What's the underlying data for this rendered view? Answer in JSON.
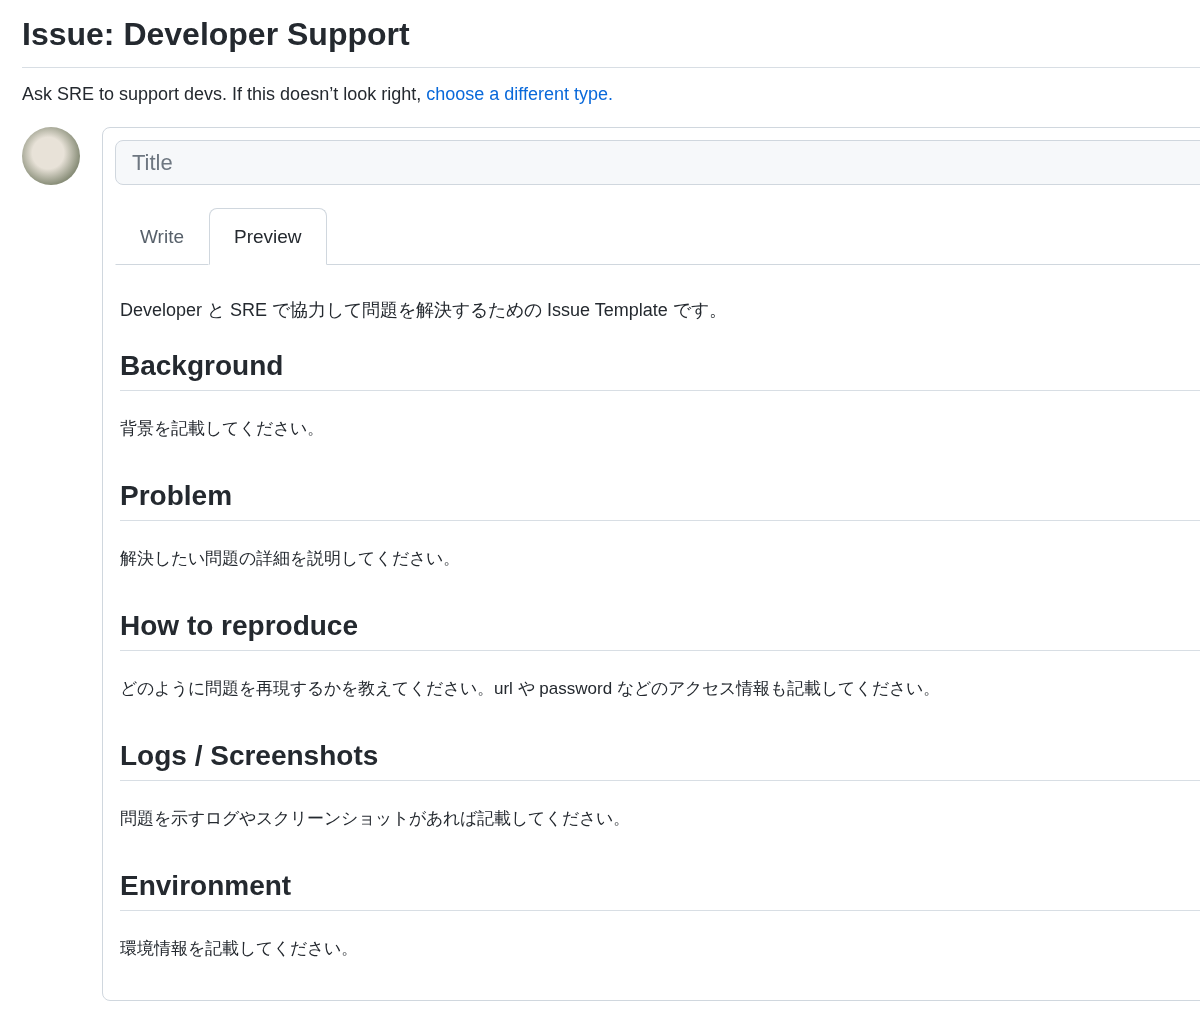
{
  "page_title": "Issue: Developer Support",
  "description": {
    "text": "Ask SRE to support devs. If this doesn’t look right, ",
    "link": "choose a different type."
  },
  "title_field": {
    "placeholder": "Title"
  },
  "tabs": [
    {
      "label": "Write",
      "selected": false
    },
    {
      "label": "Preview",
      "selected": true
    }
  ],
  "preview": {
    "intro": "Developer と SRE で協力して問題を解決するための Issue Template です。",
    "sections": [
      {
        "heading": "Background",
        "text": "背景を記載してください。"
      },
      {
        "heading": "Problem",
        "text": "解決したい問題の詳細を説明してください。"
      },
      {
        "heading": "How to reproduce",
        "text": "どのように問題を再現するかを教えてください。url や password などのアクセス情報も記載してください。"
      },
      {
        "heading": "Logs / Screenshots",
        "text": "問題を示すログやスクリーンショットがあれば記載してください。"
      },
      {
        "heading": "Environment",
        "text": "環境情報を記載してください。"
      }
    ]
  }
}
